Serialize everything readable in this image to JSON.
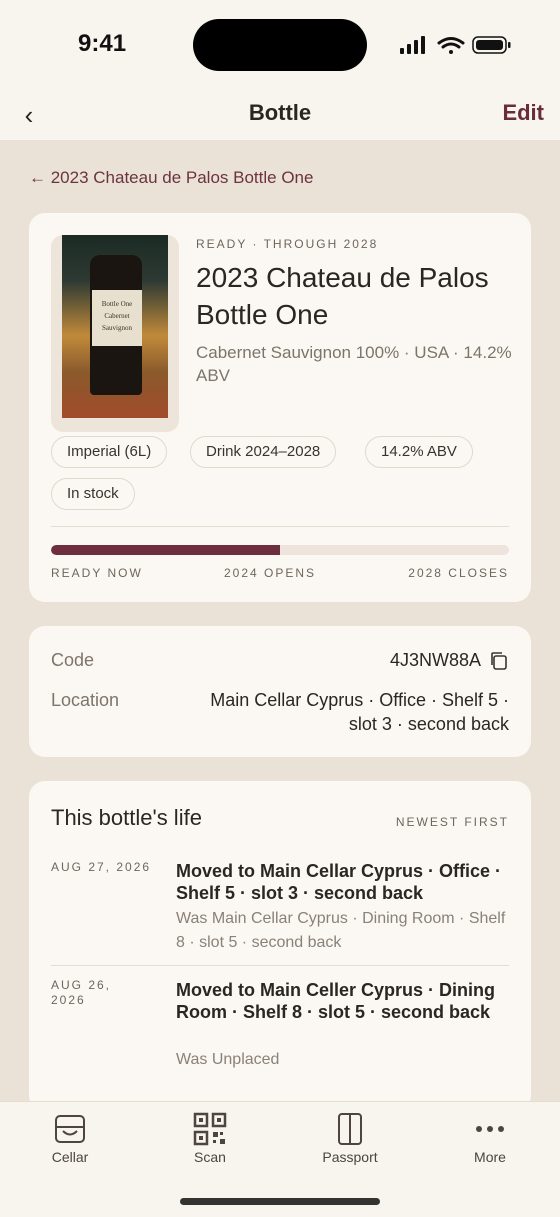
{
  "status_bar": {
    "time": "9:41"
  },
  "nav": {
    "title": "Bottle",
    "edit_label": "Edit",
    "back_glyph": "‹"
  },
  "breadcrumb": "← 2023 Chateau de Palos Bottle One",
  "wine": {
    "readiness": "READY · THROUGH 2028",
    "name": "2023 Chateau de Palos Bottle One",
    "details": "Cabernet Sauvignon 100% · USA · 14.2% ABV",
    "photo_label_line1": "Bottle One",
    "photo_label_line2": "Cabernet Sauvignon",
    "chips": [
      "Imperial (6L)",
      "Drink 2024–2028",
      "14.2% ABV",
      "In stock"
    ]
  },
  "drinking_window": {
    "progress_fraction": 0.5,
    "labels": [
      "READY NOW",
      "2024 OPENS",
      "2028 CLOSES"
    ]
  },
  "info": {
    "code_label": "Code",
    "code_value": "4J3NW88A",
    "location_label": "Location",
    "location_value_line1": "Main Cellar Cyprus · Office · Shelf 5 ·",
    "location_value_line2": "slot 3 · second back"
  },
  "life": {
    "title": "This bottle's life",
    "sort_label": "NEWEST FIRST",
    "events": [
      {
        "date": "AUG 27, 2026",
        "main": "Moved to Main Cellar Cyprus · Office · Shelf 5 · slot 3 · second back",
        "was": "Was Main Cellar Cyprus · Dining Room · Shelf 8 · slot 5 · second back"
      },
      {
        "date": "AUG 26, 2026",
        "main": "Moved to Main Celler Cyprus · Dining Room · Shelf 8 · slot 5 · second back",
        "was": "Was Unplaced"
      }
    ]
  },
  "tabs": [
    {
      "label": "Cellar",
      "icon": "cellar-icon"
    },
    {
      "label": "Scan",
      "icon": "qr-code-icon"
    },
    {
      "label": "Passport",
      "icon": "passport-icon"
    },
    {
      "label": "More",
      "icon": "more-icon"
    }
  ],
  "colors": {
    "accent": "#6e2e3d",
    "background": "#ebe2d7",
    "card": "#fbf8f3"
  }
}
